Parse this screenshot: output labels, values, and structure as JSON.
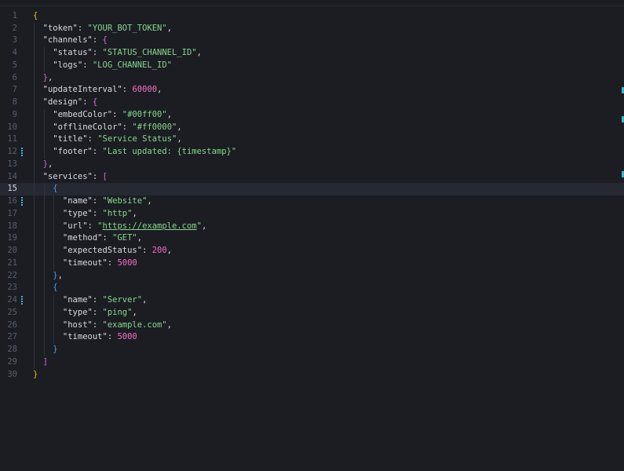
{
  "editor": {
    "current_line": 15,
    "lines": [
      {
        "n": "1",
        "indent": 0,
        "tokens": [
          {
            "t": "{",
            "c": "t-b1"
          }
        ]
      },
      {
        "n": "2",
        "indent": 1,
        "tokens": [
          {
            "t": "\"token\"",
            "c": "t-key"
          },
          {
            "t": ": ",
            "c": "t-punct"
          },
          {
            "t": "\"YOUR_BOT_TOKEN\"",
            "c": "t-str"
          },
          {
            "t": ",",
            "c": "t-punct"
          }
        ]
      },
      {
        "n": "3",
        "indent": 1,
        "tokens": [
          {
            "t": "\"channels\"",
            "c": "t-key"
          },
          {
            "t": ": ",
            "c": "t-punct"
          },
          {
            "t": "{",
            "c": "t-b2"
          }
        ]
      },
      {
        "n": "4",
        "indent": 2,
        "tokens": [
          {
            "t": "\"status\"",
            "c": "t-key"
          },
          {
            "t": ": ",
            "c": "t-punct"
          },
          {
            "t": "\"STATUS_CHANNEL_ID\"",
            "c": "t-str"
          },
          {
            "t": ",",
            "c": "t-punct"
          }
        ]
      },
      {
        "n": "5",
        "indent": 2,
        "tokens": [
          {
            "t": "\"logs\"",
            "c": "t-key"
          },
          {
            "t": ": ",
            "c": "t-punct"
          },
          {
            "t": "\"LOG_CHANNEL_ID\"",
            "c": "t-str"
          }
        ]
      },
      {
        "n": "6",
        "indent": 1,
        "tokens": [
          {
            "t": "}",
            "c": "t-b2"
          },
          {
            "t": ",",
            "c": "t-punct"
          }
        ]
      },
      {
        "n": "7",
        "indent": 1,
        "tokens": [
          {
            "t": "\"updateInterval\"",
            "c": "t-key"
          },
          {
            "t": ": ",
            "c": "t-punct"
          },
          {
            "t": "60000",
            "c": "t-num"
          },
          {
            "t": ",",
            "c": "t-punct"
          }
        ]
      },
      {
        "n": "8",
        "indent": 1,
        "tokens": [
          {
            "t": "\"design\"",
            "c": "t-key"
          },
          {
            "t": ": ",
            "c": "t-punct"
          },
          {
            "t": "{",
            "c": "t-b2"
          }
        ]
      },
      {
        "n": "9",
        "indent": 2,
        "tokens": [
          {
            "t": "\"embedColor\"",
            "c": "t-key"
          },
          {
            "t": ": ",
            "c": "t-punct"
          },
          {
            "t": "\"#00ff00\"",
            "c": "t-str"
          },
          {
            "t": ",",
            "c": "t-punct"
          }
        ]
      },
      {
        "n": "10",
        "indent": 2,
        "tokens": [
          {
            "t": "\"offlineColor\"",
            "c": "t-key"
          },
          {
            "t": ": ",
            "c": "t-punct"
          },
          {
            "t": "\"#ff0000\"",
            "c": "t-str"
          },
          {
            "t": ",",
            "c": "t-punct"
          }
        ]
      },
      {
        "n": "11",
        "indent": 2,
        "tokens": [
          {
            "t": "\"title\"",
            "c": "t-key"
          },
          {
            "t": ": ",
            "c": "t-punct"
          },
          {
            "t": "\"Service Status\"",
            "c": "t-str"
          },
          {
            "t": ",",
            "c": "t-punct"
          }
        ]
      },
      {
        "n": "12",
        "indent": 2,
        "mark": true,
        "tokens": [
          {
            "t": "\"footer\"",
            "c": "t-key"
          },
          {
            "t": ": ",
            "c": "t-punct"
          },
          {
            "t": "\"Last updated: {timestamp}\"",
            "c": "t-str"
          }
        ]
      },
      {
        "n": "13",
        "indent": 1,
        "tokens": [
          {
            "t": "}",
            "c": "t-b2"
          },
          {
            "t": ",",
            "c": "t-punct"
          }
        ]
      },
      {
        "n": "14",
        "indent": 1,
        "tokens": [
          {
            "t": "\"services\"",
            "c": "t-key"
          },
          {
            "t": ": ",
            "c": "t-punct"
          },
          {
            "t": "[",
            "c": "t-b2"
          }
        ]
      },
      {
        "n": "15",
        "indent": 2,
        "tokens": [
          {
            "t": "{",
            "c": "t-b3"
          }
        ]
      },
      {
        "n": "16",
        "indent": 3,
        "mark": true,
        "tokens": [
          {
            "t": "\"name\"",
            "c": "t-key"
          },
          {
            "t": ": ",
            "c": "t-punct"
          },
          {
            "t": "\"Website\"",
            "c": "t-str"
          },
          {
            "t": ",",
            "c": "t-punct"
          }
        ]
      },
      {
        "n": "17",
        "indent": 3,
        "tokens": [
          {
            "t": "\"type\"",
            "c": "t-key"
          },
          {
            "t": ": ",
            "c": "t-punct"
          },
          {
            "t": "\"http\"",
            "c": "t-str"
          },
          {
            "t": ",",
            "c": "t-punct"
          }
        ]
      },
      {
        "n": "18",
        "indent": 3,
        "tokens": [
          {
            "t": "\"url\"",
            "c": "t-key"
          },
          {
            "t": ": ",
            "c": "t-punct"
          },
          {
            "t": "\"",
            "c": "t-str"
          },
          {
            "t": "https://example.com",
            "c": "t-link",
            "link": true
          },
          {
            "t": "\"",
            "c": "t-str"
          },
          {
            "t": ",",
            "c": "t-punct"
          }
        ]
      },
      {
        "n": "19",
        "indent": 3,
        "tokens": [
          {
            "t": "\"method\"",
            "c": "t-key"
          },
          {
            "t": ": ",
            "c": "t-punct"
          },
          {
            "t": "\"GET\"",
            "c": "t-str"
          },
          {
            "t": ",",
            "c": "t-punct"
          }
        ]
      },
      {
        "n": "20",
        "indent": 3,
        "tokens": [
          {
            "t": "\"expectedStatus\"",
            "c": "t-key"
          },
          {
            "t": ": ",
            "c": "t-punct"
          },
          {
            "t": "200",
            "c": "t-num"
          },
          {
            "t": ",",
            "c": "t-punct"
          }
        ]
      },
      {
        "n": "21",
        "indent": 3,
        "tokens": [
          {
            "t": "\"timeout\"",
            "c": "t-key"
          },
          {
            "t": ": ",
            "c": "t-punct"
          },
          {
            "t": "5000",
            "c": "t-num"
          }
        ]
      },
      {
        "n": "22",
        "indent": 2,
        "tokens": [
          {
            "t": "}",
            "c": "t-b3"
          },
          {
            "t": ",",
            "c": "t-punct"
          }
        ]
      },
      {
        "n": "23",
        "indent": 2,
        "tokens": [
          {
            "t": "{",
            "c": "t-b3"
          }
        ]
      },
      {
        "n": "24",
        "indent": 3,
        "mark": true,
        "tokens": [
          {
            "t": "\"name\"",
            "c": "t-key"
          },
          {
            "t": ": ",
            "c": "t-punct"
          },
          {
            "t": "\"Server\"",
            "c": "t-str"
          },
          {
            "t": ",",
            "c": "t-punct"
          }
        ]
      },
      {
        "n": "25",
        "indent": 3,
        "tokens": [
          {
            "t": "\"type\"",
            "c": "t-key"
          },
          {
            "t": ": ",
            "c": "t-punct"
          },
          {
            "t": "\"ping\"",
            "c": "t-str"
          },
          {
            "t": ",",
            "c": "t-punct"
          }
        ]
      },
      {
        "n": "26",
        "indent": 3,
        "tokens": [
          {
            "t": "\"host\"",
            "c": "t-key"
          },
          {
            "t": ": ",
            "c": "t-punct"
          },
          {
            "t": "\"example.com\"",
            "c": "t-str"
          },
          {
            "t": ",",
            "c": "t-punct"
          }
        ]
      },
      {
        "n": "27",
        "indent": 3,
        "tokens": [
          {
            "t": "\"timeout\"",
            "c": "t-key"
          },
          {
            "t": ": ",
            "c": "t-punct"
          },
          {
            "t": "5000",
            "c": "t-num"
          }
        ]
      },
      {
        "n": "28",
        "indent": 2,
        "tokens": [
          {
            "t": "}",
            "c": "t-b3"
          }
        ]
      },
      {
        "n": "29",
        "indent": 1,
        "tokens": [
          {
            "t": "]",
            "c": "t-b2"
          }
        ]
      },
      {
        "n": "30",
        "indent": 0,
        "tokens": [
          {
            "t": "}",
            "c": "t-b1"
          }
        ]
      }
    ]
  }
}
